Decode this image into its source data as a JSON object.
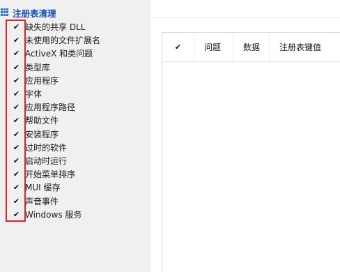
{
  "sidebar": {
    "title": "注册表清理",
    "icon": "grid-icon",
    "items": [
      {
        "label": "缺失的共享 DLL",
        "checked": true
      },
      {
        "label": "未使用的文件扩展名",
        "checked": true
      },
      {
        "label": "ActiveX 和类问题",
        "checked": true
      },
      {
        "label": "类型库",
        "checked": true
      },
      {
        "label": "应用程序",
        "checked": true
      },
      {
        "label": "字体",
        "checked": true
      },
      {
        "label": "应用程序路径",
        "checked": true
      },
      {
        "label": "帮助文件",
        "checked": true
      },
      {
        "label": "安装程序",
        "checked": true
      },
      {
        "label": "过时的软件",
        "checked": true
      },
      {
        "label": "启动时运行",
        "checked": true
      },
      {
        "label": "开始菜单排序",
        "checked": true
      },
      {
        "label": "MUI 缓存",
        "checked": true
      },
      {
        "label": "声音事件",
        "checked": true
      },
      {
        "label": "Windows 服务",
        "checked": true
      }
    ],
    "check_glyph": "✔",
    "accent_color": "#1a4fb3",
    "highlight_color": "#e8202a"
  },
  "results_table": {
    "select_all_checked": true,
    "columns": [
      "问题",
      "数据",
      "注册表键值"
    ]
  }
}
